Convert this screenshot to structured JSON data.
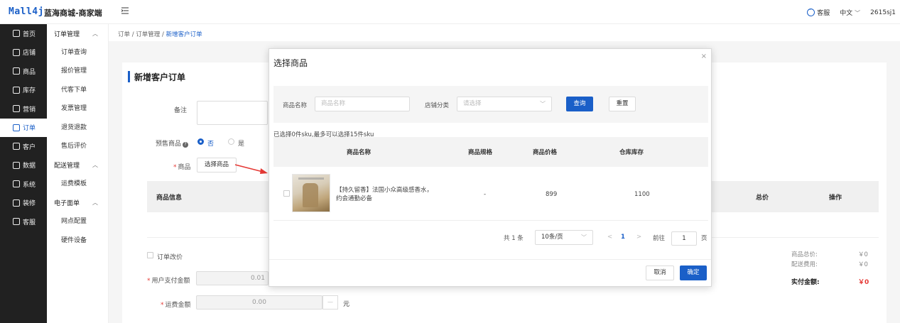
{
  "header": {
    "logo": "Mall4j",
    "app_title": "蓝海商城-商家端",
    "service": "客服",
    "language": "中文",
    "username": "2615sj1"
  },
  "nav": [
    {
      "label": "首页",
      "icon": "home-icon"
    },
    {
      "label": "店铺",
      "icon": "shop-icon"
    },
    {
      "label": "商品",
      "icon": "goods-icon"
    },
    {
      "label": "库存",
      "icon": "stock-icon"
    },
    {
      "label": "营销",
      "icon": "gift-icon"
    },
    {
      "label": "订单",
      "icon": "order-icon",
      "active": true
    },
    {
      "label": "客户",
      "icon": "customer-icon"
    },
    {
      "label": "数据",
      "icon": "data-icon"
    },
    {
      "label": "系统",
      "icon": "settings-icon"
    },
    {
      "label": "装修",
      "icon": "decorate-icon"
    },
    {
      "label": "客服",
      "icon": "chat-icon"
    }
  ],
  "submenu": {
    "order_group": "订单管理",
    "order_items": [
      "订单查询",
      "报价管理",
      "代客下单",
      "发票管理",
      "退货退款",
      "售后评价"
    ],
    "delivery_group": "配送管理",
    "delivery_items": [
      "运费模板"
    ],
    "eform_group": "电子面单",
    "eform_items": [
      "网点配置",
      "硬件设备"
    ]
  },
  "breadcrumb": {
    "l1": "订单",
    "l2": "订单管理",
    "l3": "新增客户订单",
    "sep": "/"
  },
  "form": {
    "title": "新增客户订单",
    "remark_label": "备注",
    "presale_label": "预售商品",
    "presale_no": "否",
    "presale_yes": "是",
    "goods_label": "商品",
    "select_goods_btn": "选择商品",
    "table_goods_info": "商品信息",
    "table_total": "总价",
    "table_action": "操作",
    "modify_price": "订单改价",
    "user_pay_label": "用户支付金额",
    "user_pay_value": "0.01",
    "freight_label": "运费金额",
    "freight_value": "0.00",
    "freight_unit": "元",
    "req_mark": "*",
    "goods_total_label": "商品总价:",
    "goods_total_value": "￥0",
    "delivery_fee_label": "配送费用:",
    "delivery_fee_value": "￥0",
    "actual_pay_label": "实付金额:",
    "actual_pay_value": "￥0"
  },
  "modal": {
    "title": "选择商品",
    "close": "×",
    "filter_name_label": "商品名称",
    "filter_name_placeholder": "商品名称",
    "filter_category_label": "店铺分类",
    "filter_category_placeholder": "请选择",
    "query_btn": "查询",
    "reset_btn": "重置",
    "selected_info": "已选择0件sku,最多可以选择15件sku",
    "columns": {
      "name": "商品名称",
      "spec": "商品规格",
      "price": "商品价格",
      "stock": "仓库库存"
    },
    "rows": [
      {
        "name": "【持久留香】法国小众高级感香水，约会通勤必备",
        "spec": "-",
        "price": "899",
        "stock": "1100"
      }
    ],
    "pager": {
      "total": "共 1 条",
      "page_size": "10条/页",
      "current": "1",
      "goto": "前往",
      "goto_value": "1",
      "page_unit": "页",
      "prev": "<",
      "next": ">"
    },
    "cancel_btn": "取消",
    "confirm_btn": "确定"
  },
  "colors": {
    "accent": "#1a5fc8",
    "sidebar_dark": "#212121",
    "price_red": "#e53935",
    "annotation_arrow": "#e53935"
  }
}
